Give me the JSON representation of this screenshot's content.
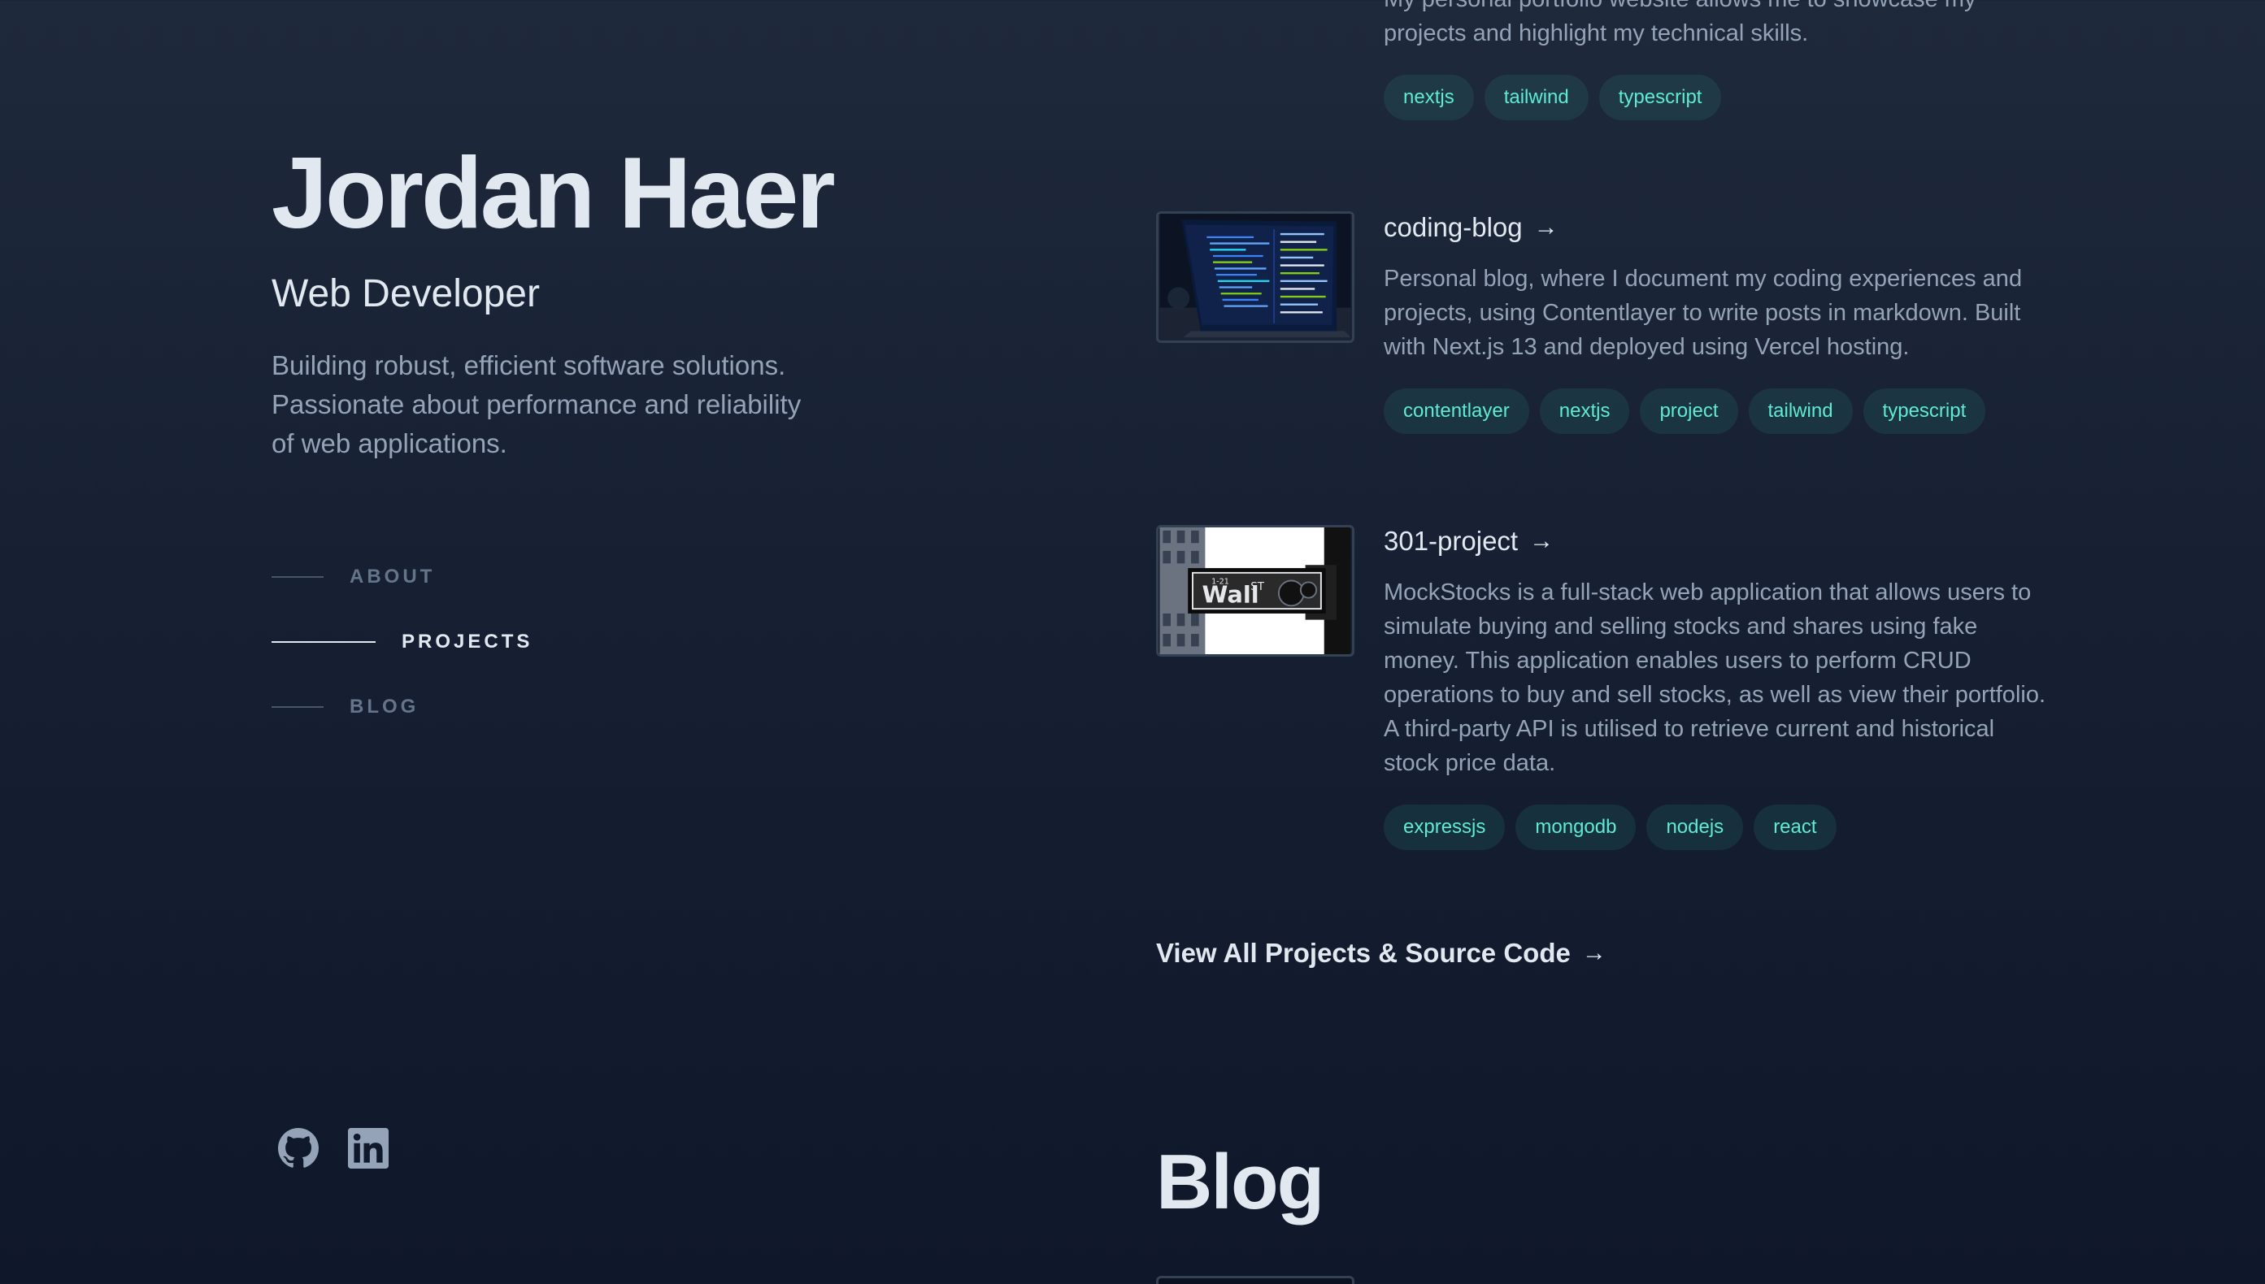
{
  "header": {
    "name": "Jordan Haer",
    "role": "Web Developer",
    "intro": "Building robust, efficient software solutions. Passionate about performance and reliability of web applications."
  },
  "nav": {
    "items": [
      {
        "label": "ABOUT",
        "active": false
      },
      {
        "label": "PROJECTS",
        "active": true
      },
      {
        "label": "BLOG",
        "active": false
      }
    ]
  },
  "socials": {
    "github": "github-icon",
    "linkedin": "linkedin-icon"
  },
  "projects": {
    "partial": {
      "description": "My personal portfolio website allows me to showcase my projects and highlight my technical skills.",
      "tags": [
        "nextjs",
        "tailwind",
        "typescript"
      ]
    },
    "items": [
      {
        "title": "coding-blog",
        "arrow": "→",
        "description": "Personal blog, where I document my coding experiences and projects, using Contentlayer to write posts in markdown. Built with Next.js 13 and deployed using Vercel hosting.",
        "tags": [
          "contentlayer",
          "nextjs",
          "project",
          "tailwind",
          "typescript"
        ]
      },
      {
        "title": "301-project",
        "arrow": "→",
        "description": "MockStocks is a full-stack web application that allows users to simulate buying and selling stocks and shares using fake money. This application enables users to perform CRUD operations to buy and sell stocks, as well as view their portfolio. A third-party API is utilised to retrieve current and historical stock price data.",
        "tags": [
          "expressjs",
          "mongodb",
          "nodejs",
          "react"
        ],
        "thumb_text": {
          "wall": "Wall",
          "st": "ST",
          "street_no": "1-21"
        }
      }
    ],
    "view_all": "View All Projects & Source Code",
    "view_all_arrow": "→"
  },
  "blog": {
    "heading": "Blog"
  },
  "colors": {
    "background_top": "#1e293b",
    "background_bottom": "#0f172a",
    "heading": "#e2e8f0",
    "body_text": "#94a3b8",
    "tag_text": "#5eead4",
    "tag_bg": "rgba(45,212,191,0.1)"
  }
}
